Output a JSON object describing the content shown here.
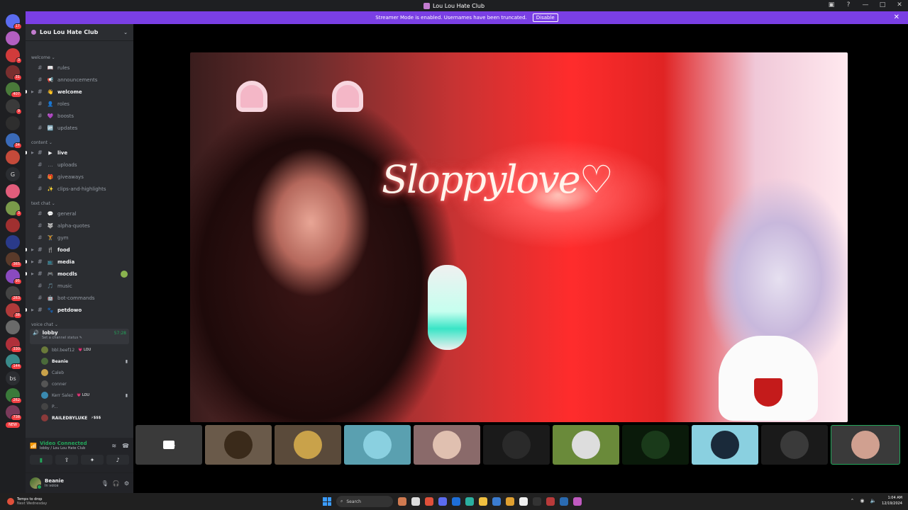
{
  "window": {
    "title": "Lou Lou Hate Club",
    "controls": [
      "▣",
      "?",
      "—",
      "□",
      "✕"
    ]
  },
  "streamer_banner": {
    "text": "Streamer Mode is enabled. Usernames have been truncated.",
    "button": "Disable",
    "close": "✕"
  },
  "guilds": [
    {
      "badge": "17",
      "color": "#5b6cf0"
    },
    {
      "badge": "",
      "color": "#b25fc0"
    },
    {
      "badge": "3",
      "color": "#d13b3b"
    },
    {
      "badge": "31",
      "color": "#7a2f2f"
    },
    {
      "badge": "407",
      "color": "#4a7a3a"
    },
    {
      "badge": "9",
      "color": "#3a3a3a"
    },
    {
      "badge": "",
      "color": "#2e2e2e"
    },
    {
      "badge": "34",
      "color": "#3a6ab8"
    },
    {
      "badge": "",
      "color": "#c44a3a"
    },
    {
      "text": "G"
    },
    {
      "badge": "",
      "color": "#e25d7b"
    },
    {
      "badge": "3",
      "color": "#7a9a4a"
    },
    {
      "badge": "",
      "color": "#a03030"
    },
    {
      "badge": "",
      "color": "#2a3a8a"
    },
    {
      "badge": "365",
      "color": "#5a3a2a"
    },
    {
      "badge": "95",
      "color": "#8a4ac0"
    },
    {
      "badge": "263",
      "color": "#444444"
    },
    {
      "badge": "38",
      "color": "#b03a3a"
    },
    {
      "badge": "",
      "color": "#6a6a6a"
    },
    {
      "badge": "330",
      "color": "#b0303a"
    },
    {
      "badge": "144",
      "color": "#3a8a8a"
    },
    {
      "text": "bs"
    },
    {
      "badge": "262",
      "color": "#3a7a3a"
    },
    {
      "badge": "738",
      "color": "#7a3a5a"
    }
  ],
  "new_label": "NEW",
  "server": {
    "name": "Lou Lou Hate Club",
    "chevron": "⌄"
  },
  "categories": [
    {
      "label": "welcome ⌄",
      "channels": [
        {
          "name": "rules",
          "emoji": "📖",
          "unread": false
        },
        {
          "name": "announcements",
          "emoji": "📢",
          "unread": false
        },
        {
          "name": "welcome",
          "emoji": "👋",
          "unread": true,
          "caret": true
        },
        {
          "name": "roles",
          "emoji": "👤",
          "unread": false
        },
        {
          "name": "boosts",
          "emoji": "💜",
          "unread": false
        },
        {
          "name": "updates",
          "emoji": "🆙",
          "unread": false
        }
      ]
    },
    {
      "label": "content ⌄",
      "channels": [
        {
          "name": "live",
          "emoji": "▶",
          "unread": true,
          "caret": true
        },
        {
          "name": "uploads",
          "emoji": "…",
          "unread": false
        },
        {
          "name": "giveaways",
          "emoji": "🎁",
          "unread": false
        },
        {
          "name": "clips-and-highlights",
          "emoji": "✨",
          "unread": false
        }
      ]
    },
    {
      "label": "text chat ⌄",
      "channels": [
        {
          "name": "general",
          "emoji": "💬",
          "unread": false
        },
        {
          "name": "alpha-quotes",
          "emoji": "🐺",
          "unread": false
        },
        {
          "name": "gym",
          "emoji": "🏋",
          "unread": false
        },
        {
          "name": "food",
          "emoji": "🍴",
          "unread": true,
          "caret": true
        },
        {
          "name": "media",
          "emoji": "📺",
          "unread": true,
          "caret": true
        },
        {
          "name": "mocdls",
          "emoji": "🎮",
          "unread": true,
          "caret": true,
          "notif": true
        },
        {
          "name": "music",
          "emoji": "🎵",
          "unread": false
        },
        {
          "name": "bot-commands",
          "emoji": "🤖",
          "unread": false
        },
        {
          "name": "petdowo",
          "emoji": "🐾",
          "unread": true,
          "caret": true
        }
      ]
    }
  ],
  "voice_category": "voice chat ⌄",
  "voice_channel": {
    "name": "lobby",
    "timer": "57:28",
    "status": "Set a channel status ✎"
  },
  "voice_users": [
    {
      "name": "bbl.beef12",
      "tag": "💗 LOU",
      "bold": false,
      "cam": false,
      "color": "#6a7a3a"
    },
    {
      "name": "Beanie",
      "tag": "",
      "bold": true,
      "cam": true,
      "color": "#4a6a3a"
    },
    {
      "name": "Caleb",
      "tag": "",
      "bold": false,
      "cam": false,
      "color": "#c9a24a"
    },
    {
      "name": "conner",
      "tag": "",
      "bold": false,
      "cam": false,
      "color": "#555555"
    },
    {
      "name": "Kerr Salez",
      "tag": "💗 LOU",
      "bold": false,
      "cam": true,
      "color": "#3a8ab0"
    },
    {
      "name": "P...",
      "tag": "",
      "bold": false,
      "cam": false,
      "color": "#444444"
    },
    {
      "name": "RAILEDBYLUKE",
      "tag": "⚡$$$",
      "bold": true,
      "cam": false,
      "color": "#8a3a3a"
    }
  ],
  "voice_panel": {
    "title": "Video Connected",
    "subtitle": "lobby / Lou Lou Hate Club"
  },
  "user": {
    "name": "Beanie",
    "status": "In voice"
  },
  "video": {
    "neon": "Sloppylove♡"
  },
  "tiles": [
    {
      "color": "#3a3a3a",
      "pic": "#111111",
      "camera": true
    },
    {
      "color": "#6a5a4a",
      "pic": "#3a2a1a",
      "camera": false
    },
    {
      "color": "#5a4a3a",
      "pic": "#c9a24a",
      "camera": false
    },
    {
      "color": "#5aa0b0",
      "pic": "#8ad0e0",
      "camera": false
    },
    {
      "color": "#8a6a6a",
      "pic": "#e0c0b0",
      "camera": false
    },
    {
      "color": "#1a1a1a",
      "pic": "#2a2a2a",
      "camera": false
    },
    {
      "color": "#6a8a3a",
      "pic": "#dddddd",
      "camera": false
    },
    {
      "color": "#0a1a0a",
      "pic": "#1a3a1a",
      "camera": false
    },
    {
      "color": "#8ad0e0",
      "pic": "#1a2a3a",
      "camera": false
    },
    {
      "color": "#1a1a1a",
      "pic": "#3a3a3a",
      "camera": false
    },
    {
      "color": "#3a3a3a",
      "pic": "#d0a090",
      "camera": false,
      "self": true
    }
  ],
  "taskbar": {
    "weather_line1": "Temps to drop",
    "weather_line2": "Next Wednesday",
    "search": "Search",
    "apps": [
      "#d07a50",
      "#dddddd",
      "#e0503a",
      "#5b6cf0",
      "#1e6fd9",
      "#2bb0a0",
      "#f0c040",
      "#3b7cd0",
      "#e0a030",
      "#f0f0f0",
      "#333333",
      "#b83a3a",
      "#2a6ab0",
      "#c05ac0"
    ],
    "time": "1:04 AM",
    "date": "12/19/2024"
  }
}
